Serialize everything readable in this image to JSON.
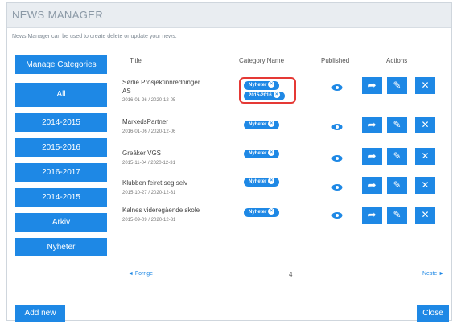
{
  "window": {
    "title": "NEWS MANAGER",
    "description": "News Manager can be used to create delete or update your news."
  },
  "sidebar": {
    "items": [
      {
        "label": "Manage Categories"
      },
      {
        "label": "All"
      },
      {
        "label": "2014-2015"
      },
      {
        "label": "2015-2016"
      },
      {
        "label": "2016-2017"
      },
      {
        "label": "2014-2015"
      },
      {
        "label": "Arkiv"
      },
      {
        "label": "Nyheter"
      }
    ]
  },
  "table": {
    "headers": {
      "title": "Title",
      "category": "Category Name",
      "published": "Published",
      "actions": "Actions"
    },
    "rows": [
      {
        "title_line1": "Sørlie Prosjektinnredninger",
        "title_line2": "AS",
        "date": "2016-01-26 / 2020-12-05",
        "categories": [
          "Nyheter",
          "2015-2016"
        ]
      },
      {
        "title_line1": "MarkedsPartner",
        "title_line2": "",
        "date": "2016-01-06 / 2020-12-06",
        "categories": [
          "Nyheter"
        ]
      },
      {
        "title_line1": "Greåker VGS",
        "title_line2": "",
        "date": "2015-11-04 / 2020-12-31",
        "categories": [
          "Nyheter"
        ]
      },
      {
        "title_line1": "Klubben feiret seg selv",
        "title_line2": "",
        "date": "2015-10-27 / 2020-12-31",
        "categories": [
          "Nyheter"
        ]
      },
      {
        "title_line1": "Kalnes videregående skole",
        "title_line2": "",
        "date": "2015-09-09 / 2020-12-31",
        "categories": [
          "Nyheter"
        ]
      }
    ]
  },
  "pager": {
    "prev": "Forrige",
    "current": "4",
    "next": "Neste"
  },
  "footer": {
    "add_label": "Add new",
    "close_label": "Close"
  },
  "colors": {
    "accent": "#1e88e5",
    "highlight": "#e53935"
  },
  "icons": {
    "published": "eye-icon",
    "share": "share-icon",
    "edit": "edit-icon",
    "delete": "close-icon"
  }
}
